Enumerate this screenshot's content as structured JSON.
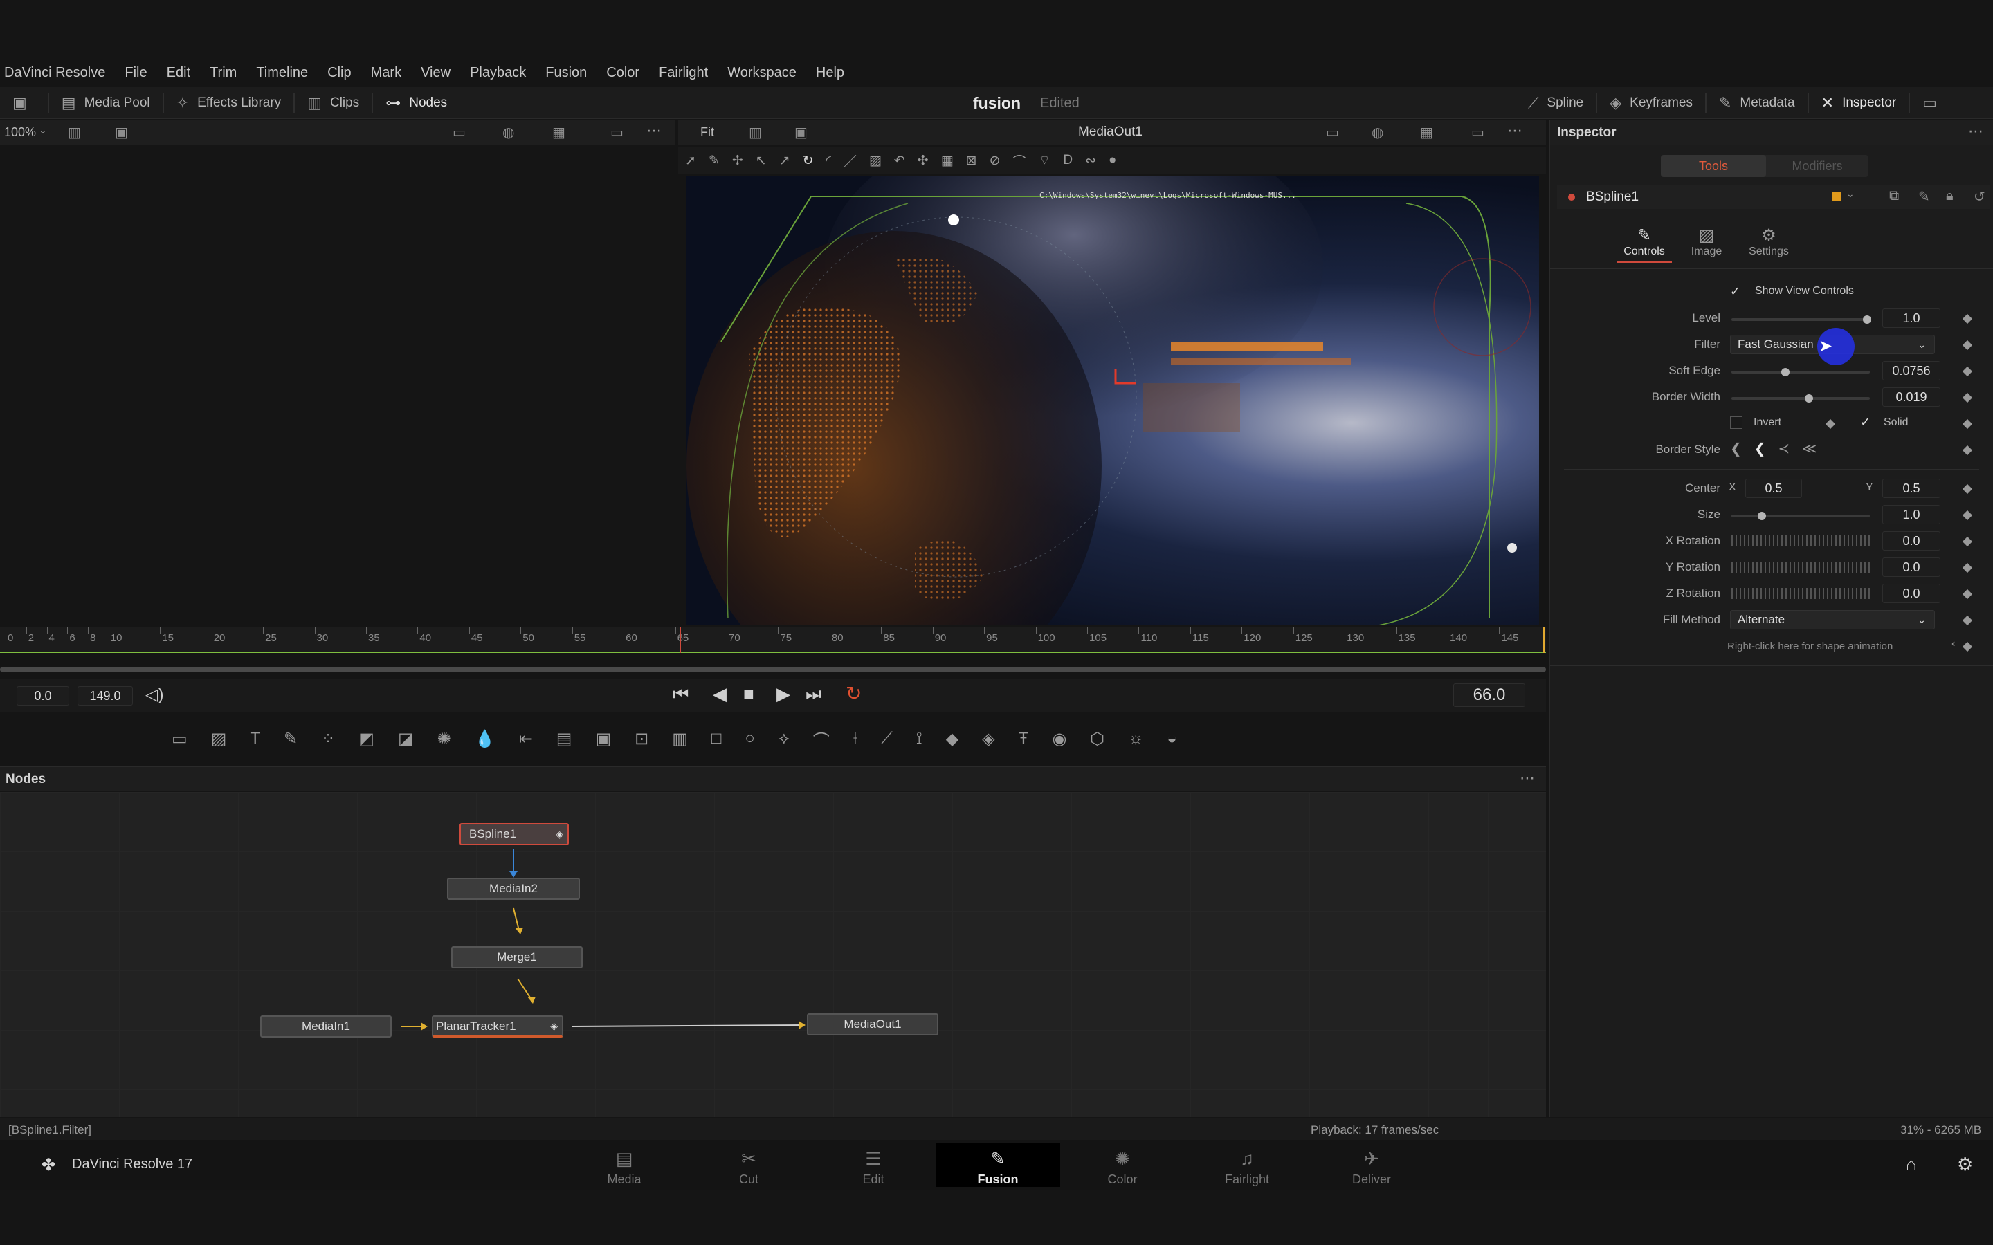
{
  "menu": {
    "items": [
      "DaVinci Resolve",
      "File",
      "Edit",
      "Trim",
      "Timeline",
      "Clip",
      "Mark",
      "View",
      "Playback",
      "Fusion",
      "Color",
      "Fairlight",
      "Workspace",
      "Help"
    ]
  },
  "toolbar": {
    "media_pool": "Media Pool",
    "effects_library": "Effects Library",
    "clips": "Clips",
    "nodes": "Nodes",
    "project_title": "fusion",
    "project_status": "Edited",
    "spline": "Spline",
    "keyframes": "Keyframes",
    "metadata": "Metadata",
    "inspector": "Inspector"
  },
  "viewer_left": {
    "zoom": "100%"
  },
  "viewer_right": {
    "zoom": "Fit",
    "title": "MediaOut1",
    "overlay_path": "C:\\Windows\\System32\\winevt\\Logs\\Microsoft-Windows-MUS..."
  },
  "ruler": {
    "labels": [
      "0",
      "2",
      "4",
      "6",
      "8",
      "10",
      "15",
      "20",
      "25",
      "30",
      "35",
      "40",
      "45",
      "50",
      "55",
      "60",
      "65",
      "70",
      "75",
      "80",
      "85",
      "90",
      "95",
      "100",
      "105",
      "110",
      "115",
      "120",
      "125",
      "130",
      "135",
      "140",
      "145"
    ],
    "playhead_frame": 66
  },
  "transport": {
    "start": "0.0",
    "end": "149.0",
    "current": "66.0"
  },
  "nodes_panel": {
    "title": "Nodes",
    "nodes": {
      "bspline": "BSpline1",
      "mediain2": "MediaIn2",
      "merge": "Merge1",
      "mediain1": "MediaIn1",
      "planar": "PlanarTracker1",
      "mediaout": "MediaOut1"
    }
  },
  "inspector": {
    "title": "Inspector",
    "tab_tools": "Tools",
    "tab_modifiers": "Modifiers",
    "node_name": "BSpline1",
    "subtabs": {
      "controls": "Controls",
      "image": "Image",
      "settings": "Settings"
    },
    "show_view_controls": "Show View Controls",
    "level": {
      "label": "Level",
      "value": "1.0",
      "fraction": 0.98
    },
    "filter": {
      "label": "Filter",
      "value": "Fast Gaussian"
    },
    "soft_edge": {
      "label": "Soft Edge",
      "value": "0.0756",
      "fraction": 0.38
    },
    "border_width": {
      "label": "Border Width",
      "value": "0.019",
      "fraction": 0.55
    },
    "invert": "Invert",
    "solid": "Solid",
    "border_style": "Border Style",
    "center": {
      "label": "Center",
      "x_label": "X",
      "x": "0.5",
      "y_label": "Y",
      "y": "0.5"
    },
    "size": {
      "label": "Size",
      "value": "1.0",
      "fraction": 0.22
    },
    "x_rotation": {
      "label": "X Rotation",
      "value": "0.0"
    },
    "y_rotation": {
      "label": "Y Rotation",
      "value": "0.0"
    },
    "z_rotation": {
      "label": "Z Rotation",
      "value": "0.0"
    },
    "fill_method": {
      "label": "Fill Method",
      "value": "Alternate"
    },
    "hint": "Right-click here for shape animation"
  },
  "status": {
    "left": "[BSpline1.Filter]",
    "playback": "Playback: 17 frames/sec",
    "memory": "31% - 6265 MB"
  },
  "pages": {
    "app_name": "DaVinci Resolve 17",
    "media": "Media",
    "cut": "Cut",
    "edit": "Edit",
    "fusion": "Fusion",
    "color": "Color",
    "fairlight": "Fairlight",
    "deliver": "Deliver"
  },
  "colors": {
    "accent": "#d04a3c",
    "orange": "#e08a2c",
    "cursor_blue": "#2230e8",
    "ruler_green": "#7fbf3f"
  }
}
